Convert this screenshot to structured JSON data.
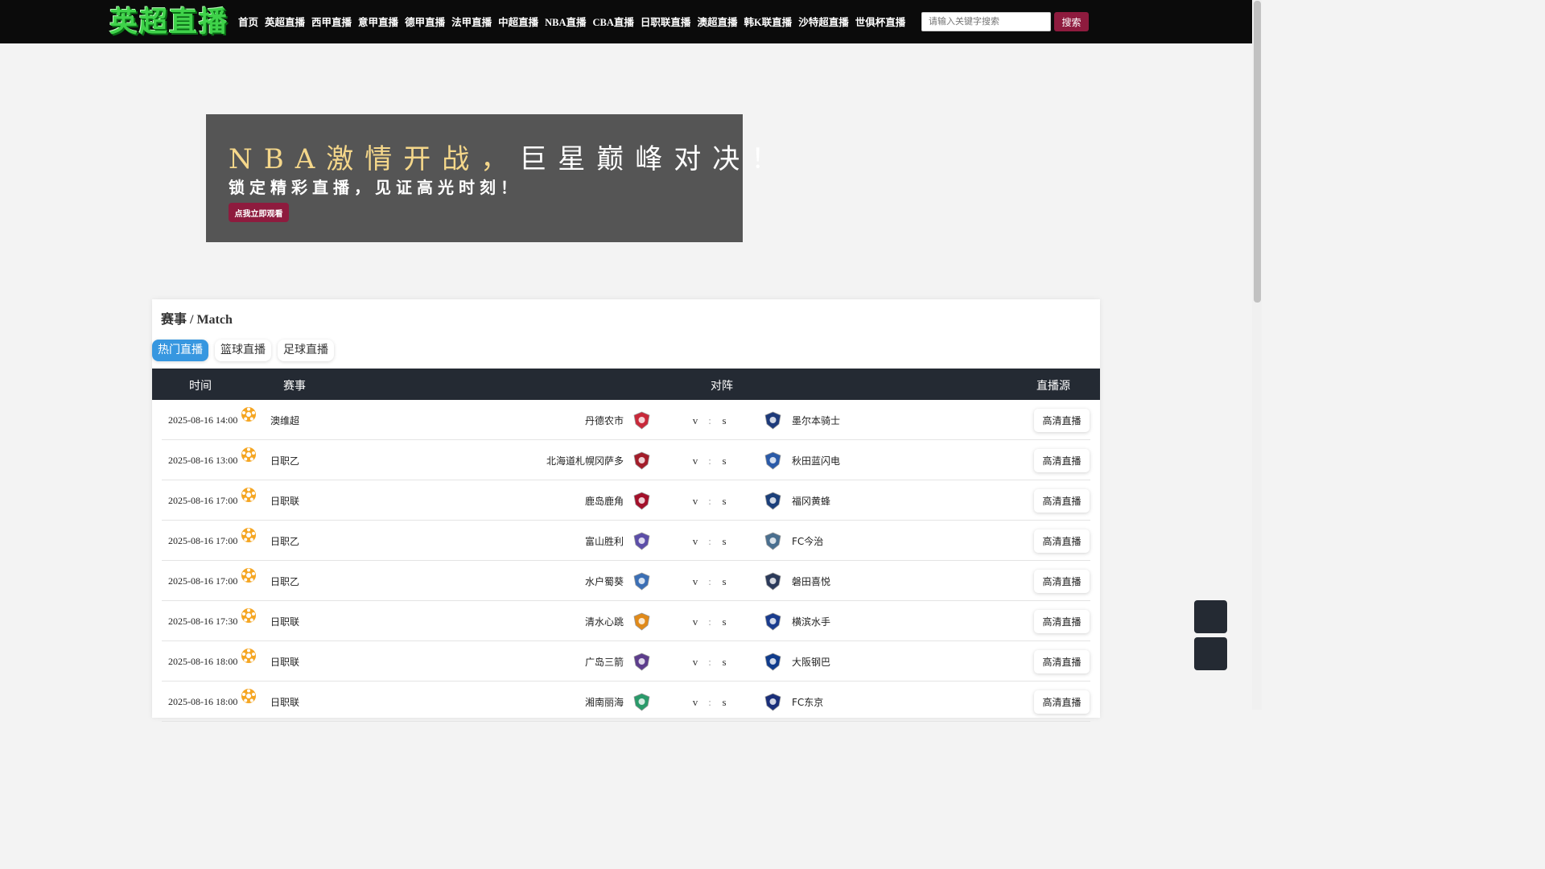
{
  "header": {
    "logo_text": "英超直播",
    "nav": [
      "首页",
      "英超直播",
      "西甲直播",
      "意甲直播",
      "德甲直播",
      "法甲直播",
      "中超直播",
      "NBA直播",
      "CBA直播",
      "日职联直播",
      "澳超直播",
      "韩K联直播",
      "沙特超直播",
      "世俱杯直播"
    ],
    "search_placeholder": "请输入关键字搜索",
    "search_button": "搜索"
  },
  "banner": {
    "title_highlight": "NBA激情开战，",
    "title_rest": "巨星巅峰对决！",
    "subtitle": "锁定精彩直播，见证高光时刻！",
    "cta": "点我立即观看"
  },
  "match_panel": {
    "title": "赛事 / Match",
    "tabs": [
      "热门直播",
      "篮球直播",
      "足球直播"
    ],
    "active_tab": 0,
    "columns": [
      "时间",
      "赛事",
      "对阵",
      "直播源"
    ],
    "rows": [
      {
        "time": "2025-08-16 14:00",
        "league": "澳维超",
        "home": "丹德农市",
        "away": "墨尔本骑士",
        "vs": [
          "v",
          ":",
          "s"
        ],
        "button": "高清直播",
        "home_color": "#c8293a",
        "away_color": "#1d3a7a"
      },
      {
        "time": "2025-08-16 13:00",
        "league": "日职乙",
        "home": "北海道札幌冈萨多",
        "away": "秋田蓝闪电",
        "vs": [
          "v",
          ":",
          "s"
        ],
        "button": "高清直播",
        "home_color": "#a31d2a",
        "away_color": "#2a5aa8"
      },
      {
        "time": "2025-08-16 17:00",
        "league": "日职联",
        "home": "鹿岛鹿角",
        "away": "福冈黄蜂",
        "vs": [
          "v",
          ":",
          "s"
        ],
        "button": "高清直播",
        "home_color": "#a3102a",
        "away_color": "#1b3f7a"
      },
      {
        "time": "2025-08-16 17:00",
        "league": "日职乙",
        "home": "富山胜利",
        "away": "FC今治",
        "vs": [
          "v",
          ":",
          "s"
        ],
        "button": "高清直播",
        "home_color": "#5c4ea8",
        "away_color": "#4a6f8f"
      },
      {
        "time": "2025-08-16 17:00",
        "league": "日职乙",
        "home": "水户蜀葵",
        "away": "磐田喜悦",
        "vs": [
          "v",
          ":",
          "s"
        ],
        "button": "高清直播",
        "home_color": "#3b6fb5",
        "away_color": "#2b3a5a"
      },
      {
        "time": "2025-08-16 17:30",
        "league": "日职联",
        "home": "清水心跳",
        "away": "横滨水手",
        "vs": [
          "v",
          ":",
          "s"
        ],
        "button": "高清直播",
        "home_color": "#e08a1a",
        "away_color": "#1a3c8e"
      },
      {
        "time": "2025-08-16 18:00",
        "league": "日职联",
        "home": "广岛三箭",
        "away": "大阪钢巴",
        "vs": [
          "v",
          ":",
          "s"
        ],
        "button": "高清直播",
        "home_color": "#5d3d8c",
        "away_color": "#103c8c"
      },
      {
        "time": "2025-08-16 18:00",
        "league": "日职联",
        "home": "湘南丽海",
        "away": "FC东京",
        "vs": [
          "v",
          ":",
          "s"
        ],
        "button": "高清直播",
        "home_color": "#2a9a6a",
        "away_color": "#1a2f7a"
      }
    ]
  },
  "colors": {
    "accent": "#8e1b3e",
    "tab_active": "#3797e0",
    "table_header": "#242a33",
    "logo_green": "#3fd24a",
    "ball_orange": "#f5a623"
  }
}
